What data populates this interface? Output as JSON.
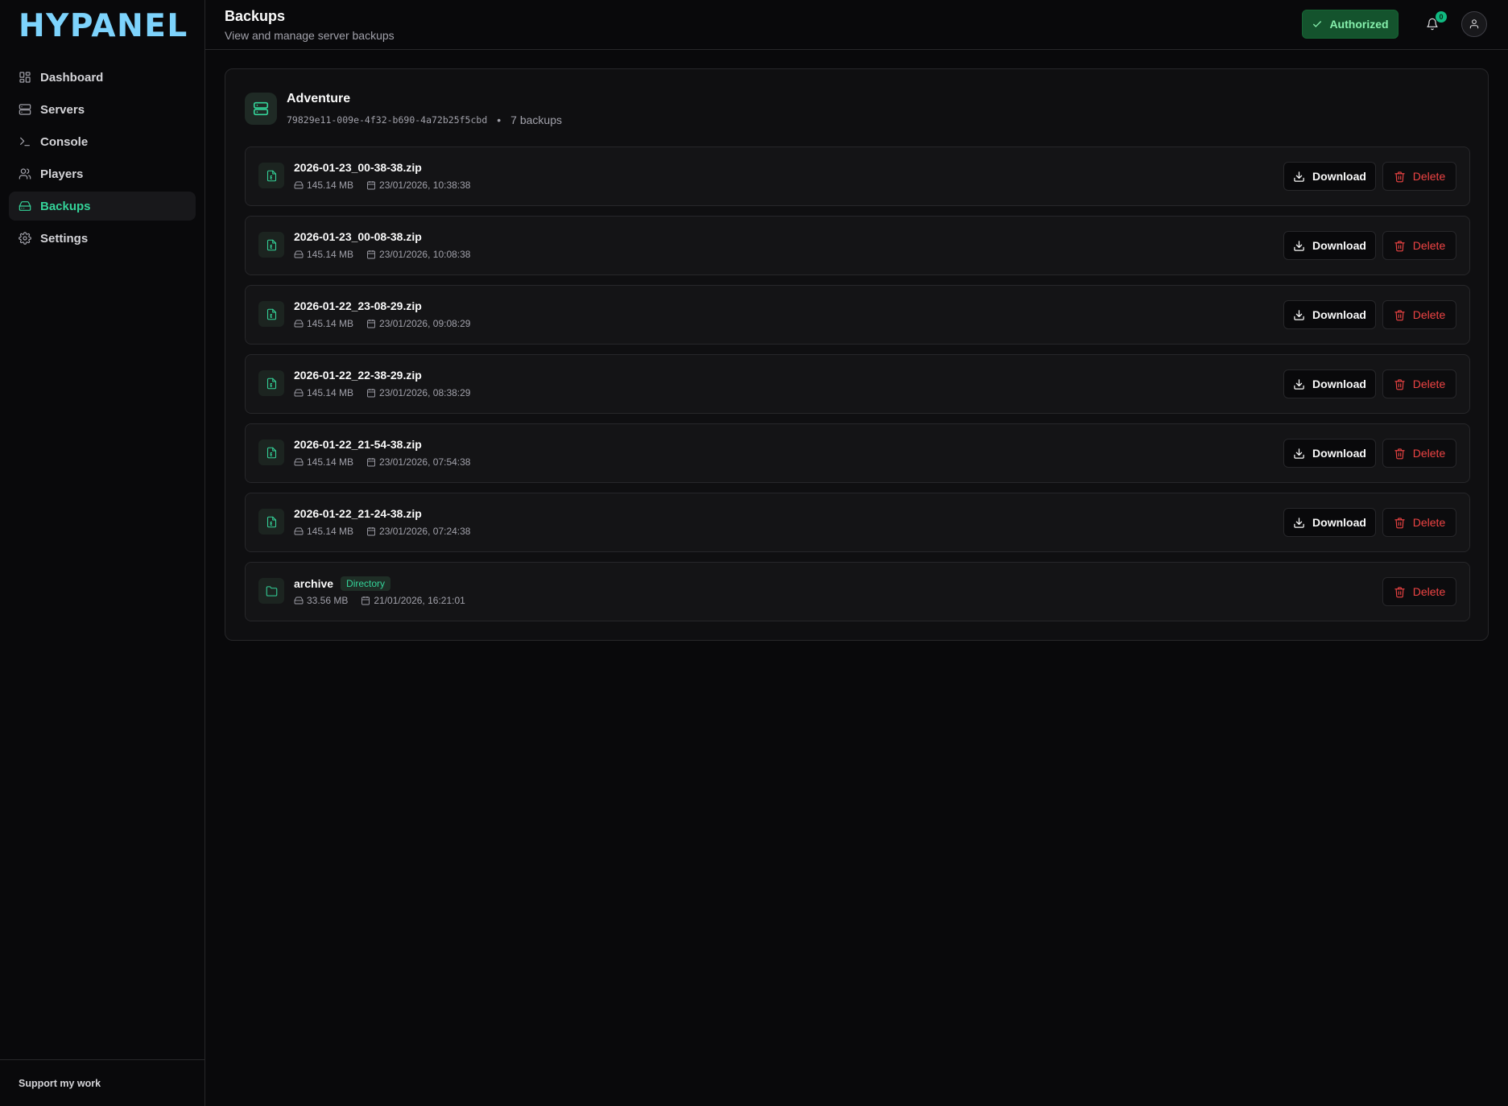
{
  "brand": {
    "logo": "HYPANEL"
  },
  "sidebar": {
    "items": [
      {
        "label": "Dashboard",
        "icon": "dashboard-icon",
        "active": false
      },
      {
        "label": "Servers",
        "icon": "servers-icon",
        "active": false
      },
      {
        "label": "Console",
        "icon": "terminal-icon",
        "active": false
      },
      {
        "label": "Players",
        "icon": "users-icon",
        "active": false
      },
      {
        "label": "Backups",
        "icon": "hard-drive-icon",
        "active": true
      },
      {
        "label": "Settings",
        "icon": "gear-icon",
        "active": false
      }
    ],
    "footer": "Support my work"
  },
  "header": {
    "title": "Backups",
    "subtitle": "View and manage server backups",
    "auth_label": "Authorized",
    "notification_count": "0"
  },
  "server": {
    "name": "Adventure",
    "id": "79829e11-009e-4f32-b690-4a72b25f5cbd",
    "separator": "•",
    "backup_count": "7 backups"
  },
  "actions": {
    "download": "Download",
    "delete": "Delete"
  },
  "backups": [
    {
      "name": "2026-01-23_00-38-38.zip",
      "size": "145.14 MB",
      "date": "23/01/2026, 10:38:38",
      "type": "file"
    },
    {
      "name": "2026-01-23_00-08-38.zip",
      "size": "145.14 MB",
      "date": "23/01/2026, 10:08:38",
      "type": "file"
    },
    {
      "name": "2026-01-22_23-08-29.zip",
      "size": "145.14 MB",
      "date": "23/01/2026, 09:08:29",
      "type": "file"
    },
    {
      "name": "2026-01-22_22-38-29.zip",
      "size": "145.14 MB",
      "date": "23/01/2026, 08:38:29",
      "type": "file"
    },
    {
      "name": "2026-01-22_21-54-38.zip",
      "size": "145.14 MB",
      "date": "23/01/2026, 07:54:38",
      "type": "file"
    },
    {
      "name": "2026-01-22_21-24-38.zip",
      "size": "145.14 MB",
      "date": "23/01/2026, 07:24:38",
      "type": "file"
    },
    {
      "name": "archive",
      "size": "33.56 MB",
      "date": "21/01/2026, 16:21:01",
      "type": "directory",
      "badge": "Directory"
    }
  ],
  "colors": {
    "accent": "#34d399",
    "danger": "#ef4444",
    "brand": "#7dd3fc"
  }
}
